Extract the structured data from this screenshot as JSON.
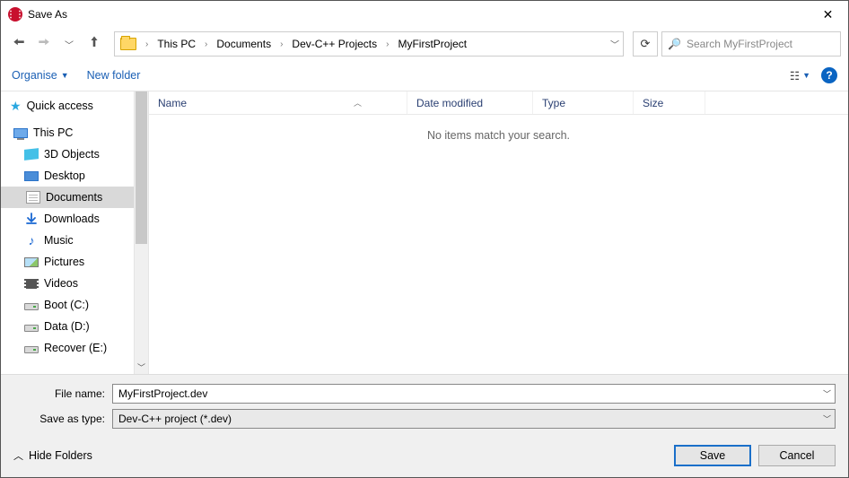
{
  "title": "Save As",
  "breadcrumb": {
    "sep": "›",
    "items": [
      "This PC",
      "Documents",
      "Dev-C++ Projects",
      "MyFirstProject"
    ]
  },
  "search": {
    "placeholder": "Search MyFirstProject"
  },
  "toolbar": {
    "organise": "Organise",
    "newfolder": "New folder"
  },
  "tree": {
    "quick": "Quick access",
    "thispc": "This PC",
    "items": [
      "3D Objects",
      "Desktop",
      "Documents",
      "Downloads",
      "Music",
      "Pictures",
      "Videos",
      "Boot (C:)",
      "Data (D:)",
      "Recover (E:)"
    ]
  },
  "columns": {
    "name": "Name",
    "date": "Date modified",
    "type": "Type",
    "size": "Size"
  },
  "empty": "No items match your search.",
  "form": {
    "filename_label": "File name:",
    "filename_value": "MyFirstProject.dev",
    "type_label": "Save as type:",
    "type_value": "Dev-C++ project (*.dev)"
  },
  "footer": {
    "hide": "Hide Folders",
    "save": "Save",
    "cancel": "Cancel"
  }
}
